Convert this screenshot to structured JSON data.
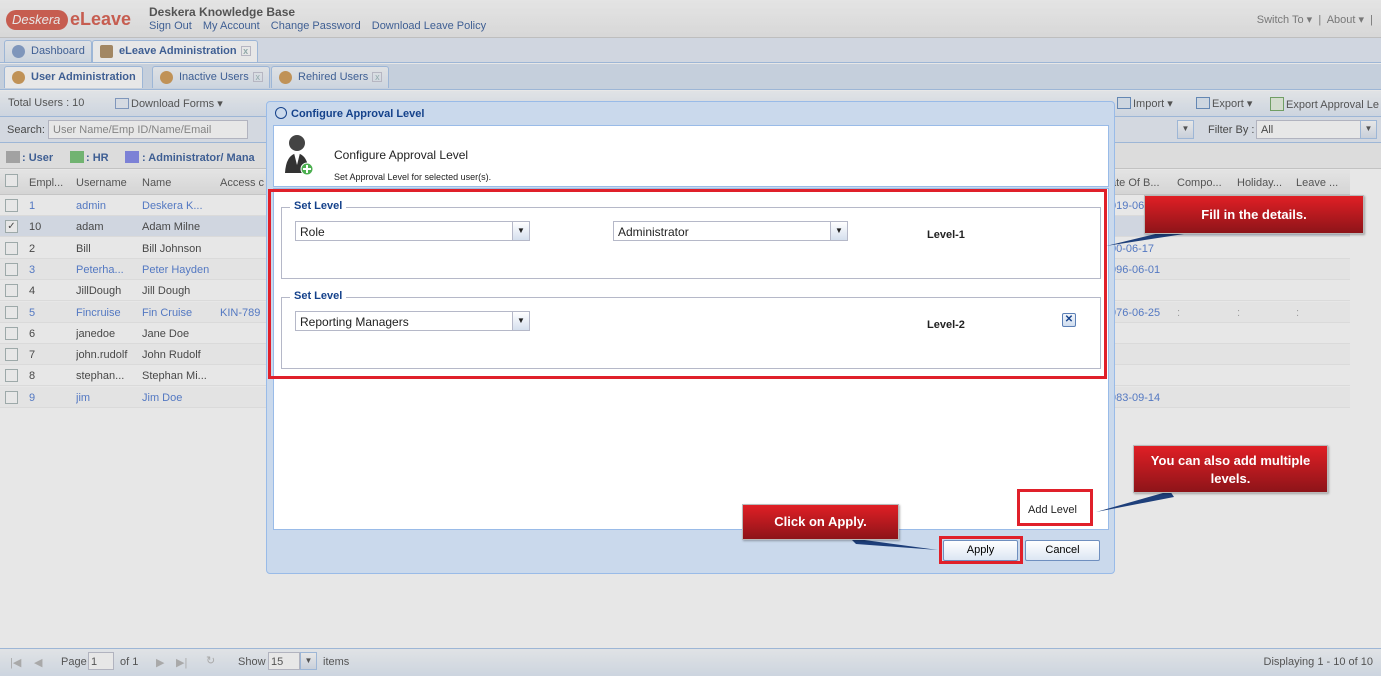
{
  "header": {
    "logo_badge": "Desk",
    "logo_badge_suffix": "era",
    "logo_text": "eLeave",
    "kb_title": "Deskera Knowledge Base",
    "links": [
      "Sign Out",
      "My Account",
      "Change Password",
      "Download Leave Policy"
    ],
    "switch_to": "Switch To ▾",
    "about": "About ▾"
  },
  "tabs": {
    "main": [
      "Dashboard",
      "eLeave Administration"
    ],
    "sub": [
      "User Administration",
      "Inactive Users",
      "Rehired Users"
    ]
  },
  "toolbar": {
    "total_users": "Total Users : 10",
    "download_forms": "Download Forms ▾",
    "import": "Import ▾",
    "export": "Export ▾",
    "export_approval": "Export Approval Le"
  },
  "search": {
    "label": "Search:",
    "placeholder": "User Name/Emp ID/Name/Email",
    "filter_label": "Filter By :",
    "filter_value": "All"
  },
  "legend": {
    "user": ": User",
    "hr": ": HR",
    "admin": ": Administrator/ Mana",
    "colors": {
      "user": "#a0a0a0",
      "hr": "#5cb85c",
      "admin": "#6b72e8"
    }
  },
  "grid": {
    "columns": [
      "Empl...",
      "Username",
      "Name",
      "Access c"
    ],
    "right_columns": [
      "ate Of B...",
      "Compo...",
      "Holiday...",
      "Leave ..."
    ],
    "rows": [
      {
        "id": "1",
        "username": "admin",
        "name": "Deskera K...",
        "access": "",
        "dob": "019-06",
        "link": true,
        "checked": false,
        "extra": ""
      },
      {
        "id": "10",
        "username": "adam",
        "name": "Adam Milne",
        "access": "",
        "dob": "",
        "link": false,
        "checked": true,
        "extra": ""
      },
      {
        "id": "2",
        "username": "Bill",
        "name": "Bill Johnson",
        "access": "",
        "dob": "00-06-17",
        "link": false,
        "checked": false,
        "extra": ""
      },
      {
        "id": "3",
        "username": "Peterha...",
        "name": "Peter Hayden",
        "access": "",
        "dob": "996-06-01",
        "link": true,
        "checked": false,
        "extra": ""
      },
      {
        "id": "4",
        "username": "JillDough",
        "name": "Jill Dough",
        "access": "",
        "dob": "",
        "link": false,
        "checked": false,
        "extra": ""
      },
      {
        "id": "5",
        "username": "Fincruise",
        "name": "Fin Cruise",
        "access": "KIN-789",
        "dob": "976-06-25",
        "link": true,
        "checked": false,
        "extra": ":"
      },
      {
        "id": "6",
        "username": "janedoe",
        "name": "Jane Doe",
        "access": "",
        "dob": "",
        "link": false,
        "checked": false,
        "extra": ""
      },
      {
        "id": "7",
        "username": "john.rudolf",
        "name": "John Rudolf",
        "access": "",
        "dob": "",
        "link": false,
        "checked": false,
        "extra": ""
      },
      {
        "id": "8",
        "username": "stephan...",
        "name": "Stephan Mi...",
        "access": "",
        "dob": "",
        "link": false,
        "checked": false,
        "extra": ""
      },
      {
        "id": "9",
        "username": "jim",
        "name": "Jim Doe",
        "access": "",
        "dob": "983-09-14",
        "link": true,
        "checked": false,
        "extra": ""
      }
    ]
  },
  "pager": {
    "page_label": "Page",
    "page_value": "1",
    "of_label": "of 1",
    "show_label": "Show",
    "show_value": "15",
    "items_label": "items",
    "displaying": "Displaying 1 - 10 of 10"
  },
  "dialog": {
    "title": "Configure Approval Level",
    "head_title": "Configure Approval Level",
    "head_sub": "Set Approval Level for selected user(s).",
    "levels": [
      {
        "legend": "Set Level",
        "type": "Role",
        "value": "Administrator",
        "label": "Level-1"
      },
      {
        "legend": "Set Level",
        "type": "Reporting Managers",
        "value": "",
        "label": "Level-2"
      }
    ],
    "add_level": "Add Level",
    "apply": "Apply",
    "cancel": "Cancel"
  },
  "callouts": {
    "fill_details": "Fill in the details.",
    "multiple_levels": "You can also add multiple levels.",
    "click_apply": "Click on Apply."
  }
}
